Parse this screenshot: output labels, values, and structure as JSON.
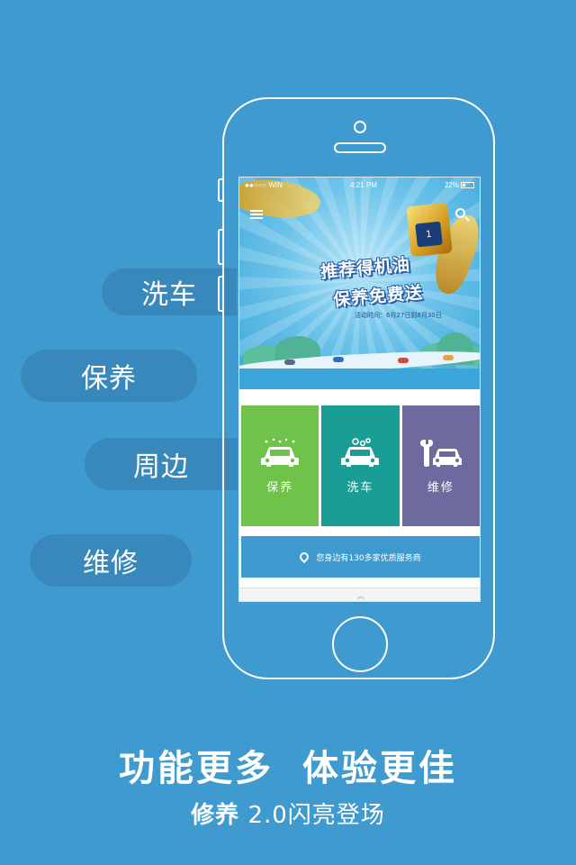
{
  "side_labels": {
    "wash": "洗车",
    "maintenance": "保养",
    "nearby": "周边",
    "repair": "维修"
  },
  "statusbar": {
    "carrier": "●●○○○ WIN",
    "time": "4:21 PM",
    "battery": "22%"
  },
  "banner": {
    "headline1": "推荐得机油",
    "headline2": "保养免费送",
    "date": "活动时间：6月27日到8月30日"
  },
  "tiles": [
    {
      "label": "保养",
      "icon": "car-sparkle-icon",
      "color": "#6fc24a"
    },
    {
      "label": "洗车",
      "icon": "car-wash-icon",
      "color": "#1a9d94"
    },
    {
      "label": "维修",
      "icon": "car-wrench-icon",
      "color": "#6c6a9e"
    }
  ],
  "providers": {
    "text": "您身边有130多家优质服务商"
  },
  "tagline": {
    "part1": "功能更多",
    "part2": "体验更佳",
    "sub_brand": "修养",
    "sub_rest": " 2.0闪亮登场"
  },
  "colors": {
    "background": "#3f9bcf",
    "label_bg": "#3888bb",
    "tile_green": "#6fc24a",
    "tile_teal": "#1a9d94",
    "tile_purple": "#6c6a9e"
  }
}
